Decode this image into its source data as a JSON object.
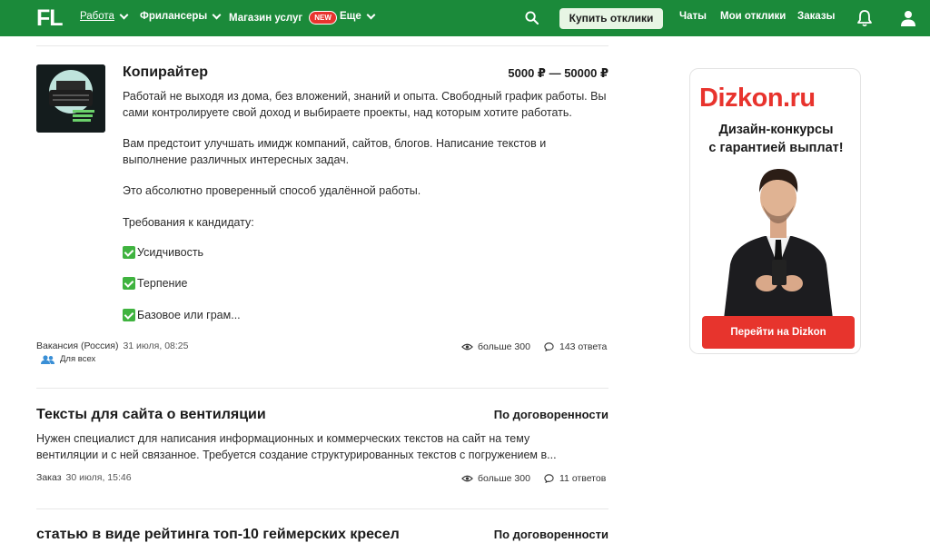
{
  "header": {
    "logo": "FL",
    "nav": [
      {
        "label": "Работа",
        "dropdown": true,
        "active": true
      },
      {
        "label": "Фрилансеры",
        "dropdown": true
      },
      {
        "label": "Магазин услуг",
        "badge": "NEW"
      },
      {
        "label": "Еще",
        "dropdown": true
      }
    ],
    "buy_button": "Купить отклики",
    "links": [
      "Чаты",
      "Мои отклики",
      "Заказы"
    ],
    "icons": [
      "search-icon",
      "bell-icon",
      "user-icon"
    ],
    "accent_color": "#1b8a3a"
  },
  "projects": [
    {
      "title": "Копирайтер",
      "price": "5000 ₽ — 50000 ₽",
      "paragraphs": [
        "Работай не выходя из дома, без вложений, знаний и опыта. Свободный график работы. Вы сами контролируете свой доход и выбираете проекты, над которым хотите работать.",
        "Вам предстоит улучшать имидж компаний, сайтов, блогов. Написание текстов и выполнение различных интересных задач.",
        "Это абсолютно проверенный способ удалённой работы.",
        "Требования к кандидату:"
      ],
      "requirements": [
        "Усидчивость",
        "Терпение",
        "Базовое или грам..."
      ],
      "type": "Вакансия (Россия)",
      "date": "31 июля, 08:25",
      "audience": "Для всех",
      "views": "больше 300",
      "responses": "143 ответа"
    },
    {
      "title": "Тексты для сайта о вентиляции",
      "price": "По договоренности",
      "description": "Нужен специалист для написания информационных и коммерческих текстов на сайт на тему вентиляции и с ней связанное. Требуется создание структурированных текстов с погружением в...",
      "type": "Заказ",
      "date": "30 июля, 15:46",
      "views": "больше 300",
      "responses": "11 ответов"
    },
    {
      "title": "статью в виде рейтинга топ-10 геймерских кресел",
      "price": "По договоренности"
    }
  ],
  "ad": {
    "brand": "Dizkon.ru",
    "tagline_1": "Дизайн-конкурсы",
    "tagline_2": "с гарантией выплат!",
    "button": "Перейти на Dizkon",
    "brand_color": "#e8332d"
  }
}
